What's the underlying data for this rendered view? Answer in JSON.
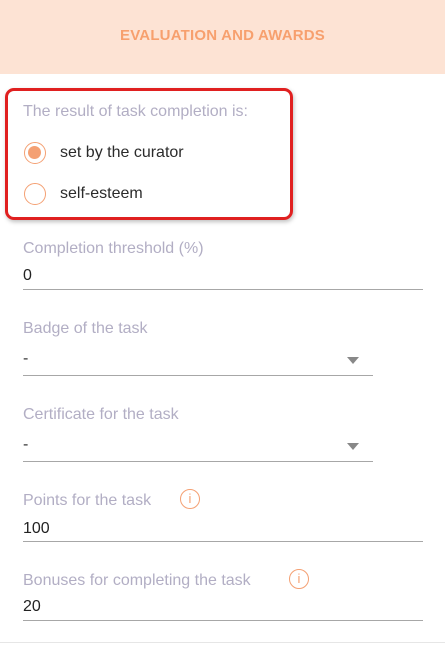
{
  "header": {
    "title": "EVALUATION AND AWARDS"
  },
  "result": {
    "label": "The result of task completion is:",
    "options": [
      {
        "label": "set by the curator",
        "selected": true
      },
      {
        "label": "self-esteem",
        "selected": false
      }
    ]
  },
  "threshold": {
    "label": "Completion threshold (%)",
    "value": "0"
  },
  "badge": {
    "label": "Badge of the task",
    "value": "-"
  },
  "certificate": {
    "label": "Certificate for the task",
    "value": "-"
  },
  "points": {
    "label": "Points for the task",
    "value": "100",
    "icon": "info-icon"
  },
  "bonuses": {
    "label": "Bonuses for completing the task",
    "value": "20",
    "icon": "info-icon"
  },
  "colors": {
    "accent": "#f4a073",
    "header_bg": "#fde3d4",
    "highlight": "#e02020",
    "label": "#b2aec4"
  }
}
